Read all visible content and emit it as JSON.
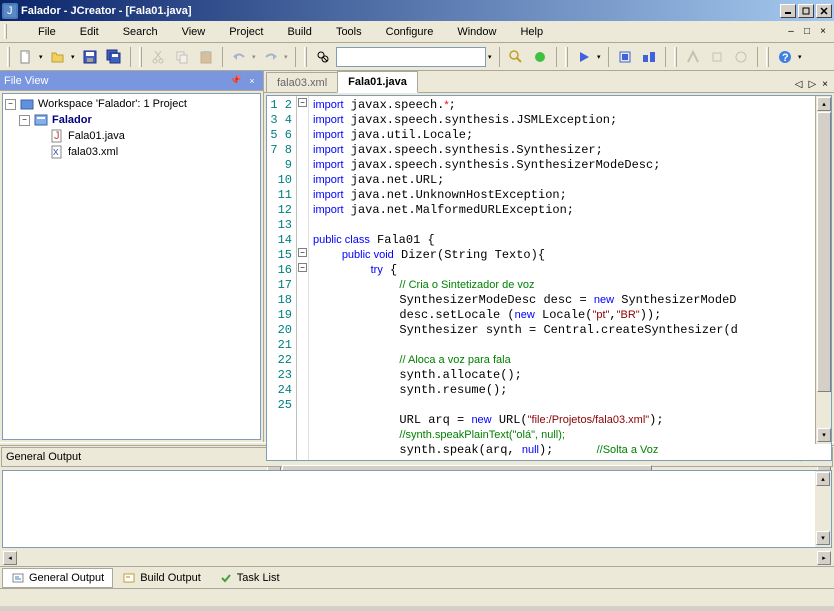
{
  "title": "Falador - JCreator - [Fala01.java]",
  "menu": [
    "File",
    "Edit",
    "Search",
    "View",
    "Project",
    "Build",
    "Tools",
    "Configure",
    "Window",
    "Help"
  ],
  "fileview": {
    "title": "File View",
    "workspace": "Workspace 'Falador': 1 Project",
    "project": "Falador",
    "files": [
      "Fala01.java",
      "fala03.xml"
    ]
  },
  "tabs": [
    "fala03.xml",
    "Fala01.java"
  ],
  "activeTab": 1,
  "code": {
    "lines": 25
  },
  "output": {
    "title": "General Output"
  },
  "bottomTabs": [
    "General Output",
    "Build Output",
    "Task List"
  ],
  "activeBottomTab": 0
}
